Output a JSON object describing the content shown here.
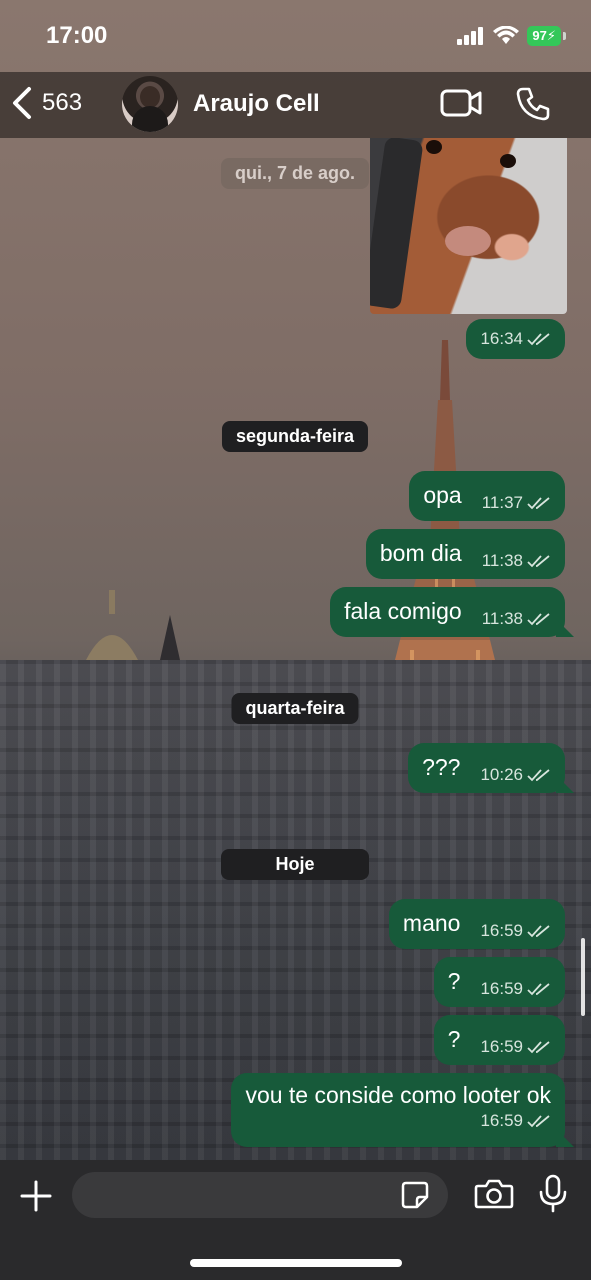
{
  "status_bar": {
    "time": "17:00",
    "battery": "97"
  },
  "header": {
    "back_count": "563",
    "contact_name": "Araujo Cell"
  },
  "chat": {
    "dates": {
      "first": "qui., 7 de ago.",
      "second": "segunda-feira",
      "third": "quarta-feira",
      "fourth": "Hoje"
    },
    "photo_message": {
      "time": "16:34"
    },
    "messages": [
      {
        "text": "opa",
        "time": "11:37"
      },
      {
        "text": "bom dia",
        "time": "11:38"
      },
      {
        "text": "fala comigo",
        "time": "11:38"
      },
      {
        "text": "???",
        "time": "10:26"
      },
      {
        "text": "mano",
        "time": "16:59"
      },
      {
        "text": "?",
        "time": "16:59"
      },
      {
        "text": "?",
        "time": "16:59"
      },
      {
        "text": "vou te conside como looter ok",
        "time": "16:59"
      }
    ]
  },
  "composer": {
    "placeholder": ""
  },
  "colors": {
    "outgoing_bubble": "#175a3a",
    "header_bg": "#3a322e",
    "battery_green": "#34c759"
  }
}
